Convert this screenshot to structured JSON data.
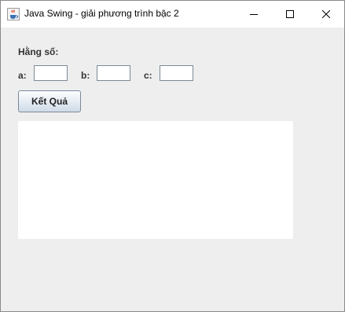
{
  "window": {
    "title": "Java Swing - giải phương trình bậc 2",
    "minimize_icon": "minimize-icon",
    "maximize_icon": "maximize-icon",
    "close_icon": "close-icon",
    "app_icon": "java-coffee-cup-icon"
  },
  "form": {
    "constants_label": "Hằng số:",
    "a_label": "a:",
    "b_label": "b:",
    "c_label": "c:",
    "a_value": "",
    "b_value": "",
    "c_value": "",
    "result_button": "Kết Quả",
    "output_text": ""
  }
}
